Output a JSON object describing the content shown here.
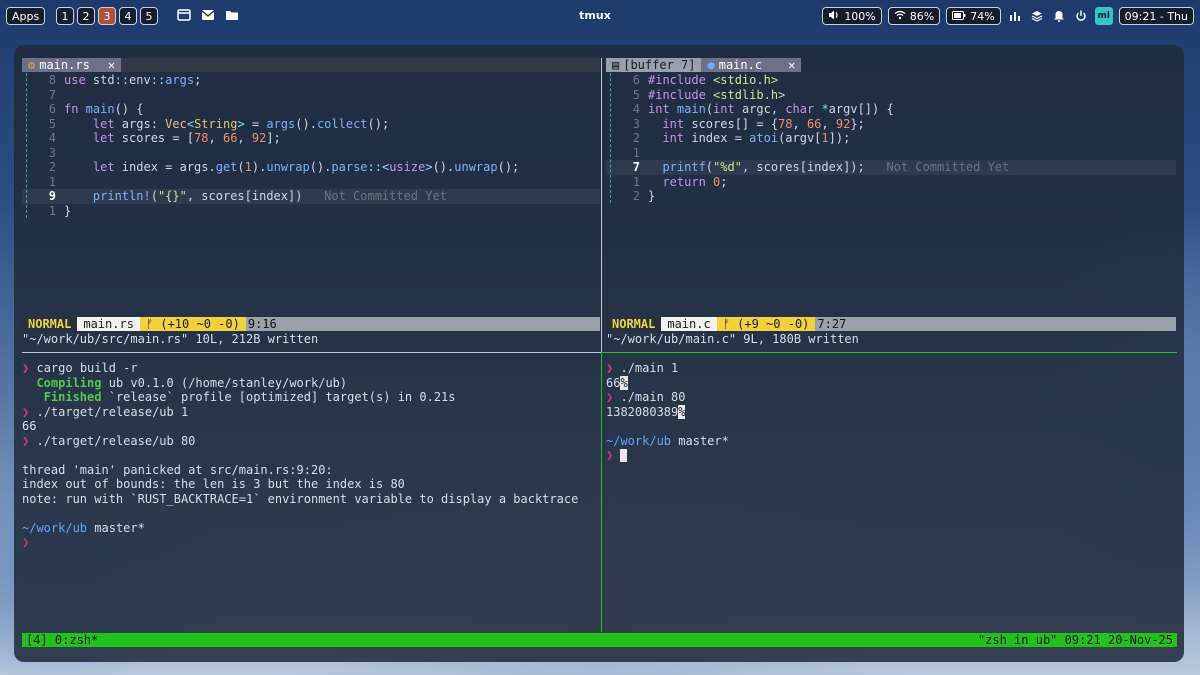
{
  "topbar": {
    "apps_label": "Apps",
    "workspaces": [
      "1",
      "2",
      "3",
      "4",
      "5"
    ],
    "active_workspace": "3",
    "title": "tmux",
    "volume": "100%",
    "wifi": "86%",
    "battery": "74%",
    "badge": "ml",
    "clock": "09:21 - Thu"
  },
  "left_editor": {
    "tab_label": "main.rs",
    "tab_close": "✕",
    "lines": [
      {
        "n": "8",
        "code": "use std::env::args;"
      },
      {
        "n": "7",
        "code": ""
      },
      {
        "n": "6",
        "code": "fn main() {"
      },
      {
        "n": "5",
        "code": "    let args: Vec<String> = args().collect();"
      },
      {
        "n": "4",
        "code": "    let scores = [78, 66, 92];"
      },
      {
        "n": "3",
        "code": ""
      },
      {
        "n": "2",
        "code": "    let index = args.get(1).unwrap().parse::<usize>().unwrap();"
      },
      {
        "n": "1",
        "code": ""
      },
      {
        "n": "9",
        "code": "    println!(\"{}\", scores[index])"
      },
      {
        "n": "1",
        "code": "}"
      }
    ],
    "blame": "Not Committed Yet",
    "status": {
      "mode": "NORMAL",
      "file": "main.rs",
      "git": "ᚠ (+10 ~0 -0)",
      "pos": "9:16"
    },
    "cmdline": "\"~/work/ub/src/main.rs\" 10L, 212B written"
  },
  "right_editor": {
    "tab_buffer": "[buffer 7]",
    "tab_label": "main.c",
    "tab_close": "✕",
    "lines": [
      {
        "n": "6",
        "code": "#include <stdio.h>"
      },
      {
        "n": "5",
        "code": "#include <stdlib.h>"
      },
      {
        "n": "4",
        "code": "int main(int argc, char *argv[]) {"
      },
      {
        "n": "3",
        "code": "  int scores[] = {78, 66, 92};"
      },
      {
        "n": "2",
        "code": "  int index = atoi(argv[1]);"
      },
      {
        "n": "1",
        "code": ""
      },
      {
        "n": "7",
        "code": "  printf(\"%d\", scores[index]);"
      },
      {
        "n": "1",
        "code": "  return 0;"
      },
      {
        "n": "2",
        "code": "}"
      }
    ],
    "blame": "Not Committed Yet",
    "status": {
      "mode": "NORMAL",
      "file": "main.c",
      "git": "ᚠ (+9 ~0 -0)",
      "pos": "7:27"
    },
    "cmdline": "\"~/work/ub/main.c\" 9L, 180B written"
  },
  "left_shell": {
    "prompt_symbol": "❯",
    "cmd1": "cargo build -r",
    "compiling_word": "Compiling",
    "compiling_rest": "ub v0.1.0 (/home/stanley/work/ub)",
    "finished_word": "Finished",
    "finished_rest": "`release` profile [optimized] target(s) in 0.21s",
    "cmd2": "./target/release/ub 1",
    "out2": "66",
    "cmd3": "./target/release/ub 80",
    "panic1": "thread 'main' panicked at src/main.rs:9:20:",
    "panic2": "index out of bounds: the len is 3 but the index is 80",
    "panic3": "note: run with `RUST_BACKTRACE=1` environment variable to display a backtrace",
    "dir": "~/work/ub",
    "branch": "master*"
  },
  "right_shell": {
    "prompt_symbol": "❯",
    "cmd1": "./main 1",
    "out1": "66",
    "cmd2": "./main 80",
    "out2": "1382080389",
    "percent": "%",
    "dir": "~/work/ub",
    "branch": "master*"
  },
  "tmux": {
    "left": "[4] 0:zsh*",
    "right": "\"zsh in ub\" 09:21 20-Nov-25"
  }
}
